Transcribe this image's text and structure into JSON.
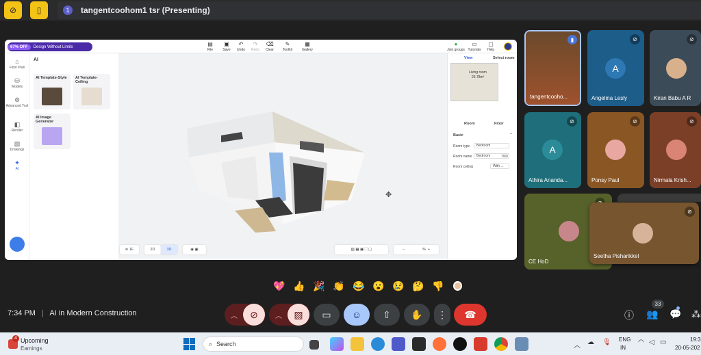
{
  "meeting": {
    "presenter_badge": "1",
    "presenting_title": "tangentcoohom1 tsr (Presenting)",
    "time": "7:34 PM",
    "separator": "|",
    "name": "AI in Modern Construction",
    "participant_count": "33"
  },
  "app": {
    "promo_off": "67% OFF",
    "promo_text": "Design Without Limits",
    "toolbar": [
      {
        "label": "File",
        "icon": "file-icon"
      },
      {
        "label": "Save",
        "icon": "save-icon"
      },
      {
        "label": "Undo",
        "icon": "undo-icon"
      },
      {
        "label": "Redo",
        "icon": "redo-icon"
      },
      {
        "label": "Clear",
        "icon": "clear-icon"
      },
      {
        "label": "Toolkit",
        "icon": "toolkit-icon"
      },
      {
        "label": "Gallery",
        "icon": "gallery-icon"
      }
    ],
    "right_toolbar": [
      {
        "label": "Join groups"
      },
      {
        "label": "Tutorials"
      },
      {
        "label": "Help"
      }
    ],
    "left_nav": [
      "Floor Plan",
      "Models",
      "Advanced Tool",
      "Render",
      "Drawings",
      "AI"
    ],
    "ai_panel": {
      "title": "AI",
      "cards": [
        "AI Template-Style",
        "AI Template-Ceiling",
        "AI Image Generator"
      ]
    },
    "right_panel": {
      "tabs": [
        "View",
        "Select room"
      ],
      "minimap_label": "Living room",
      "minimap_area": "26.78m²",
      "sub_tabs": [
        "Room",
        "Floor"
      ],
      "section": "Basic",
      "rows": [
        {
          "label": "Room type",
          "value": "Bedroom"
        },
        {
          "label": "Room name",
          "value": "Bedroom",
          "extra": "7/60"
        },
        {
          "label": "Room ceiling",
          "value": "With ..."
        }
      ]
    },
    "bottom": {
      "floor": "1F",
      "view2d": "2D",
      "view3d": "3D",
      "zoom": "%"
    }
  },
  "participants": [
    {
      "name": "tangentcooho...",
      "type": "video",
      "bg": "#5a3b24"
    },
    {
      "name": "Angelina Lesly",
      "type": "letter",
      "letter": "A",
      "bg": "#1d5d8a",
      "avatar_bg": "#2e78b4"
    },
    {
      "name": "Kiran Babu A R",
      "type": "photo",
      "bg": "#3c4b58"
    },
    {
      "name": "Athira Ananda...",
      "type": "letter",
      "letter": "A",
      "bg": "#1e6f7b",
      "avatar_bg": "#2c8b98"
    },
    {
      "name": "Ponsy Paul",
      "type": "photo",
      "bg": "#8a5624"
    },
    {
      "name": "Nirmala Krish...",
      "type": "photo",
      "bg": "#7b3f28"
    },
    {
      "name": "CE HoD",
      "type": "photo",
      "bg": "#57612a"
    },
    {
      "name": "Seetha Pisharikkel",
      "type": "photo",
      "bg": "#76552f"
    }
  ],
  "reactions": [
    "💖",
    "👍",
    "🎉",
    "👏",
    "😂",
    "😮",
    "😢",
    "🤔",
    "👎"
  ],
  "taskbar": {
    "badge": "4",
    "weather_title": "Upcoming",
    "weather_sub": "Earnings",
    "search_placeholder": "Search",
    "lang_top": "ENG",
    "lang_bottom": "IN",
    "clock_time": "19:3",
    "clock_date": "20-05-202"
  }
}
